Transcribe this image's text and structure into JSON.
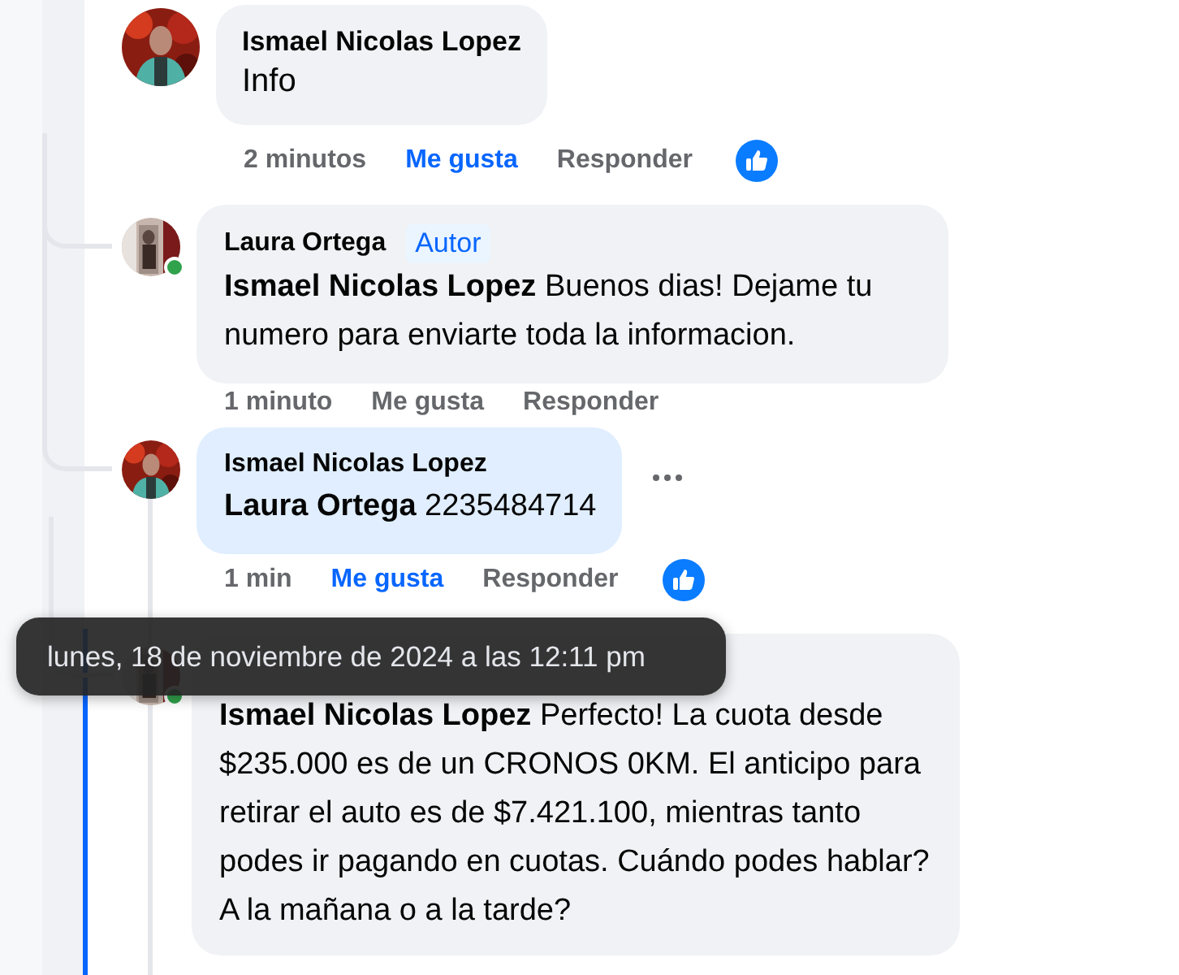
{
  "comments": [
    {
      "author": "Ismael Nicolas Lopez",
      "text": "Info",
      "time": "2 minutos",
      "like_label": "Me gusta",
      "liked": true,
      "reply_label": "Responder",
      "like_reaction": true,
      "replies": [
        {
          "author": "Laura Ortega",
          "badge": "Autor",
          "text": "**Ismael Nicolas Lopez** Buenos dias! Dejame tu numero para enviarte toda la informacion.",
          "time": "1 minuto",
          "like_label": "Me gusta",
          "liked": false,
          "reply_label": "Responder",
          "online": true
        },
        {
          "author": "Ismael Nicolas Lopez",
          "text": "**Laura Ortega** 2235484714",
          "time": "1 min",
          "like_label": "Me gusta",
          "liked": true,
          "reply_label": "Responder",
          "like_reaction": true,
          "highlighted": true,
          "has_menu": true,
          "replies": [
            {
              "text": "**Ismael Nicolas Lopez** Perfecto! La cuota desde $235.000 es de un CRONOS 0KM. El anticipo para retirar el auto es de $7.421.100, mientras tanto podes ir pagando en cuotas. Cuándo podes hablar? A la mañana o a la tarde?",
              "online": true
            }
          ]
        }
      ]
    }
  ],
  "tooltip": {
    "text": "lunes, 18 de noviembre de 2024 a las 12:11 pm"
  }
}
